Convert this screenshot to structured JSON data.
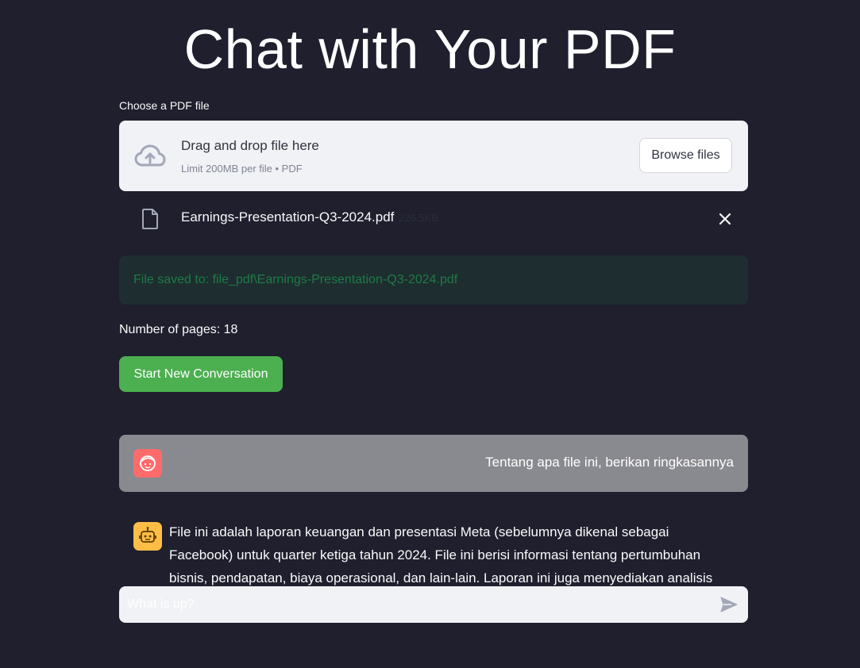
{
  "page": {
    "title": "Chat with Your PDF"
  },
  "uploader": {
    "label": "Choose a PDF file",
    "drop_text": "Drag and drop file here",
    "limit_text": "Limit 200MB per file • PDF",
    "browse_label": "Browse files",
    "icon": "cloud-upload-icon"
  },
  "uploaded_file": {
    "name": "Earnings-Presentation-Q3-2024.pdf",
    "size": "226.5KB",
    "icon": "file-icon",
    "remove_icon": "close-icon"
  },
  "alert": {
    "text": "File saved to: file_pdf\\Earnings-Presentation-Q3-2024.pdf"
  },
  "info": {
    "pages_text": "Number of pages: 18"
  },
  "actions": {
    "start_label": "Start New Conversation"
  },
  "chat": {
    "messages": [
      {
        "role": "user",
        "avatar_icon": "user-face-icon",
        "text": "Tentang apa file ini, berikan ringkasannya"
      },
      {
        "role": "assistant",
        "avatar_icon": "robot-icon",
        "text": "File ini adalah laporan keuangan dan presentasi Meta (sebelumnya dikenal sebagai Facebook) untuk quarter ketiga tahun 2024. File ini berisi informasi tentang pertumbuhan bisnis, pendapatan, biaya operasional, dan lain-lain. Laporan ini juga menyediakan analisis terkait bisnisnya."
      }
    ],
    "input_placeholder": "What is up?",
    "send_icon": "send-icon"
  },
  "colors": {
    "background": "#1f1f2e",
    "primary_button": "#4caf50",
    "user_avatar": "#ff6b6b",
    "bot_avatar": "#ffbd45",
    "success_text": "#1e7a47"
  }
}
